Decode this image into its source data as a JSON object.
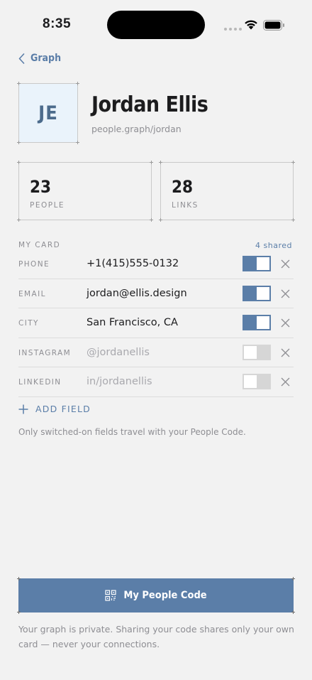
{
  "status_bar": {
    "time": "8:35"
  },
  "nav": {
    "back_label": "Graph"
  },
  "profile": {
    "initials": "JE",
    "name": "Jordan Ellis",
    "handle": "people.graph/jordan",
    "accent_color": "#5b7ea8",
    "avatar_background": "#eaf3fb"
  },
  "stats": [
    {
      "value": "23",
      "label": "PEOPLE"
    },
    {
      "value": "28",
      "label": "LINKS"
    }
  ],
  "my_card": {
    "title": "MY CARD",
    "shared_count": "4 shared",
    "fields": [
      {
        "label": "PHONE",
        "value": "+1(415)555-0132",
        "enabled": true
      },
      {
        "label": "EMAIL",
        "value": "jordan@ellis.design",
        "enabled": true
      },
      {
        "label": "CITY",
        "value": "San Francisco, CA",
        "enabled": true
      },
      {
        "label": "INSTAGRAM",
        "value": "@jordanellis",
        "enabled": false
      },
      {
        "label": "LINKEDIN",
        "value": "in/jordanellis",
        "enabled": false
      }
    ],
    "add_field_label": "ADD FIELD",
    "hint": "Only switched-on fields travel with your People Code."
  },
  "cta": {
    "label": "My People Code",
    "icon": "qr-code-icon"
  },
  "footnote": "Your graph is private. Sharing your code shares only your own card — never your connections."
}
